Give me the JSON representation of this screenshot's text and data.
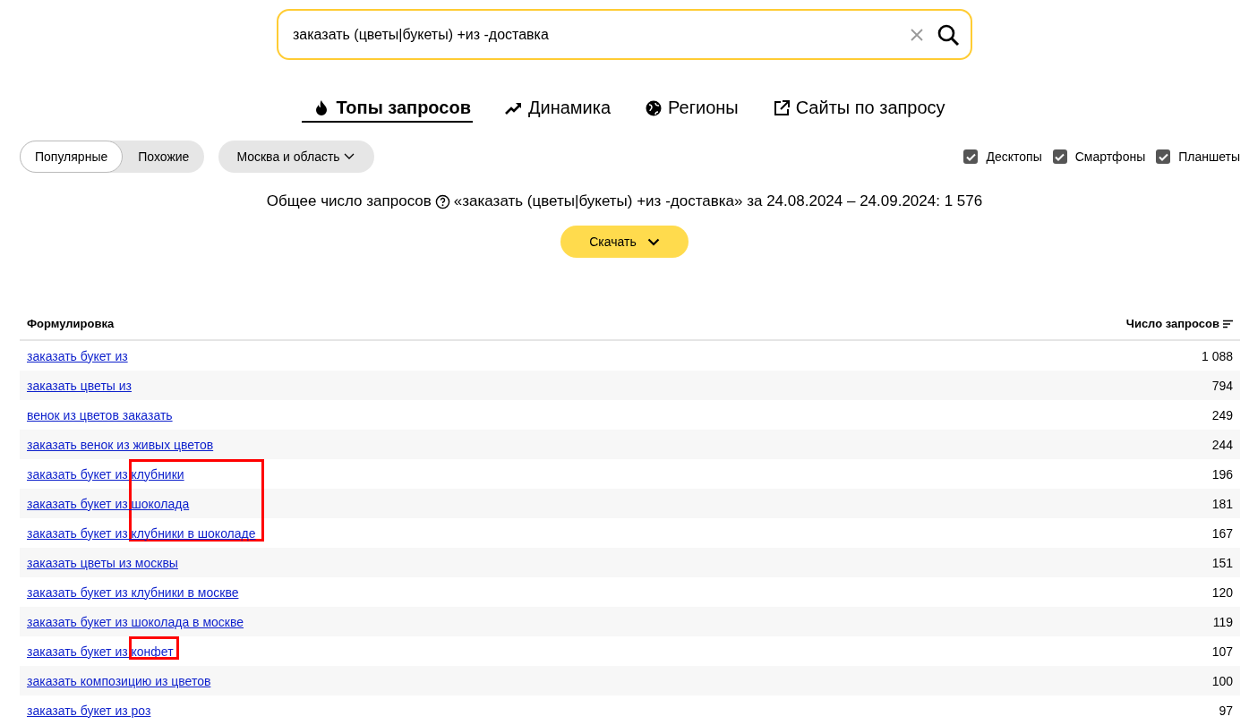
{
  "search": {
    "value": "заказать (цветы|букеты) +из -доставка"
  },
  "tabs": [
    {
      "label": "Топы запросов",
      "selected": true
    },
    {
      "label": "Динамика",
      "selected": false
    },
    {
      "label": "Регионы",
      "selected": false
    },
    {
      "label": "Сайты по запросу",
      "selected": false
    }
  ],
  "mode_switch": [
    {
      "label": "Популярные",
      "selected": true
    },
    {
      "label": "Похожие",
      "selected": false
    }
  ],
  "region": {
    "label": "Москва и область"
  },
  "devices": [
    {
      "label": "Десктопы",
      "checked": true
    },
    {
      "label": "Смартфоны",
      "checked": true
    },
    {
      "label": "Планшеты",
      "checked": true
    }
  ],
  "total": {
    "label": "Общее число запросов",
    "text": "«заказать (цветы|букеты) +из -доставка» за 24.08.2024 – 24.09.2024: 1 576"
  },
  "download_button": "Скачать",
  "table": {
    "columns": [
      "Формулировка",
      "Число запросов"
    ],
    "rows": [
      {
        "phrase": "заказать букет из",
        "count": "1 088",
        "highlighted": false
      },
      {
        "phrase": "заказать цветы из",
        "count": "794",
        "highlighted": false
      },
      {
        "phrase": "венок из цветов заказать",
        "count": "249",
        "highlighted": false
      },
      {
        "phrase": "заказать венок из живых цветов",
        "count": "244",
        "highlighted": false
      },
      {
        "phrase": "заказать букет из клубники",
        "count": "196",
        "highlighted": true
      },
      {
        "phrase": "заказать букет из шоколада",
        "count": "181",
        "highlighted": true
      },
      {
        "phrase": "заказать букет из клубники в шоколаде",
        "count": "167",
        "highlighted": true
      },
      {
        "phrase": "заказать цветы из москвы",
        "count": "151",
        "highlighted": false
      },
      {
        "phrase": "заказать букет из клубники в москве",
        "count": "120",
        "highlighted": false
      },
      {
        "phrase": "заказать букет из шоколада в москве",
        "count": "119",
        "highlighted": false
      },
      {
        "phrase": "заказать букет из конфет",
        "count": "107",
        "highlighted": true
      },
      {
        "phrase": "заказать композицию из цветов",
        "count": "100",
        "highlighted": false
      },
      {
        "phrase": "заказать букет из роз",
        "count": "97",
        "highlighted": false
      }
    ]
  }
}
